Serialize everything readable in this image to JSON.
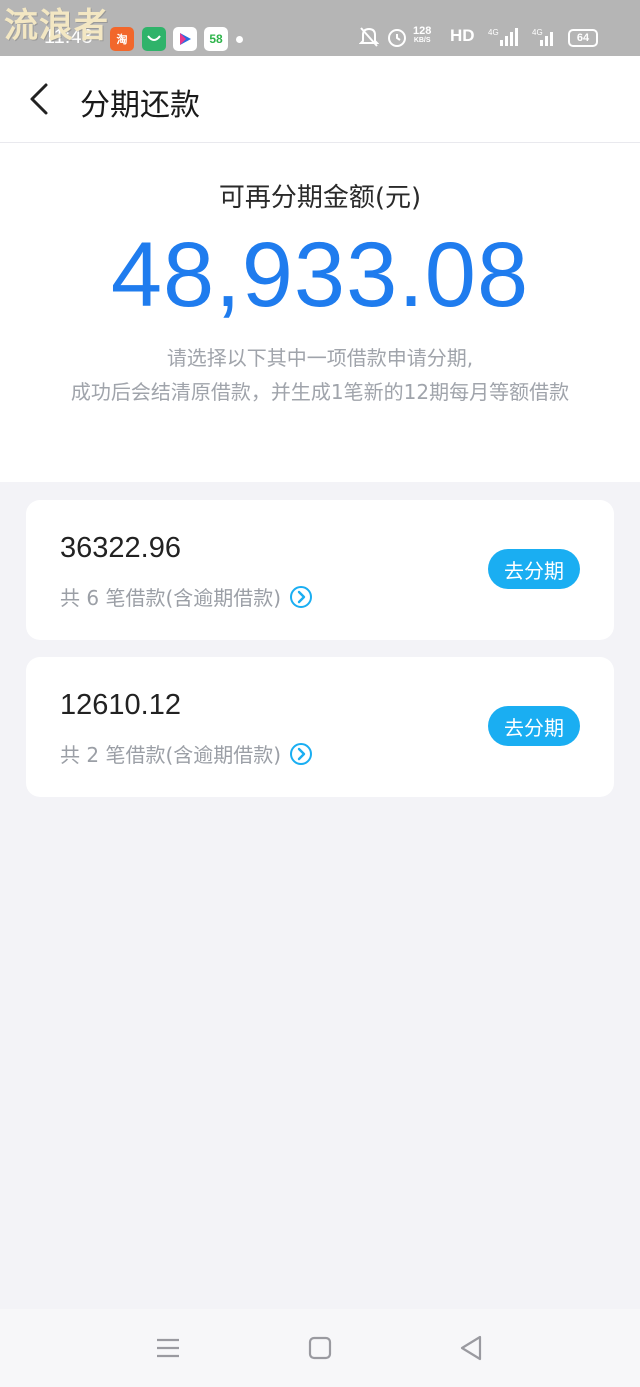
{
  "status_bar": {
    "watermark": "流浪者",
    "time": "11:48",
    "app_taobao": "淘",
    "app_fiveeight": "58",
    "net_speed_value": "128",
    "net_speed_unit": "KB/S",
    "hd_label": "HD",
    "battery": "64"
  },
  "header": {
    "title": "分期还款"
  },
  "summary": {
    "label": "可再分期金额(元)",
    "amount": "48,933.08",
    "desc_line1": "请选择以下其中一项借款申请分期,",
    "desc_line2": "成功后会结清原借款，并生成1笔新的12期每月等额借款"
  },
  "loans": [
    {
      "amount": "36322.96",
      "count_text": "共 6 笔借款(含逾期借款)",
      "button": "去分期"
    },
    {
      "amount": "12610.12",
      "count_text": "共 2 笔借款(含逾期借款)",
      "button": "去分期"
    }
  ],
  "colors": {
    "accent_amount": "#1f7cee",
    "button_bg": "#1aaef2"
  },
  "icons": [
    "back-arrow-icon",
    "chevron-circle-icon",
    "mute-bell-icon",
    "alarm-icon",
    "signal-icon",
    "battery-icon",
    "menu-icon",
    "home-square-icon",
    "back-triangle-icon"
  ]
}
